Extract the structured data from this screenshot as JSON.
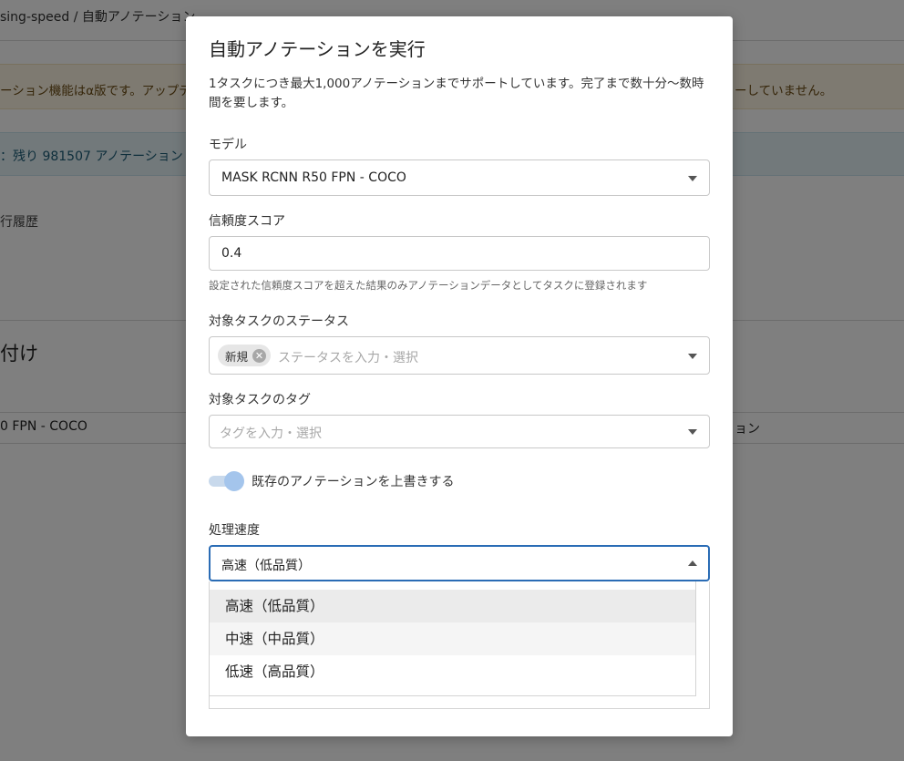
{
  "background": {
    "breadcrumb": "sing-speed  /  自動アノテーション",
    "warning_left": "ーション機能はα版です。アップデ",
    "warning_right": "ーしていません。",
    "info": "：残り 981507 アノテーション",
    "history": "行履歴",
    "section_title": "付け",
    "row_model": "0 FPN - COCO",
    "row_right": "ョン"
  },
  "modal": {
    "title": "自動アノテーションを実行",
    "description": "1タスクにつき最大1,000アノテーションまでサポートしています。完了まで数十分〜数時間を要します。",
    "model": {
      "label": "モデル",
      "value": "MASK RCNN R50 FPN - COCO"
    },
    "confidence": {
      "label": "信頼度スコア",
      "value": "0.4",
      "help": "設定された信頼度スコアを超えた結果のみアノテーションデータとしてタスクに登録されます"
    },
    "status": {
      "label": "対象タスクのステータス",
      "chip": "新規",
      "placeholder": "ステータスを入力・選択"
    },
    "tags": {
      "label": "対象タスクのタグ",
      "placeholder": "タグを入力・選択"
    },
    "overwrite": {
      "label": "既存のアノテーションを上書きする",
      "checked": true
    },
    "speed": {
      "label": "処理速度",
      "value": "高速（低品質）",
      "options": [
        "高速（低品質）",
        "中速（中品質）",
        "低速（高品質）"
      ],
      "selected_index": 0,
      "hover_index": 1
    }
  },
  "colors": {
    "focus_border": "#2a6cb5",
    "toggle_knob": "#a4c5ec",
    "warning_bg": "#fcf4e3",
    "info_bg": "#e4f2f7",
    "option_selected_bg": "#ebebeb",
    "option_hover_bg": "#f5f5f5"
  }
}
